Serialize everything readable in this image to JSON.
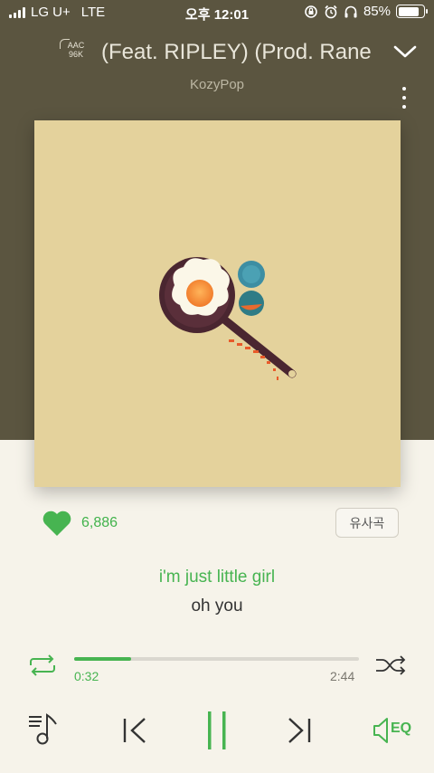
{
  "status_bar": {
    "carrier": "LG U+",
    "network": "LTE",
    "time": "오후 12:01",
    "battery": "85%",
    "battery_level": 0.85
  },
  "header": {
    "codec_line1": "AAC",
    "codec_line2": "96K",
    "title": "(Feat. RIPLEY) (Prod. Rane",
    "artist": "KozyPop"
  },
  "like": {
    "count": "6,886",
    "similar_label": "유사곡"
  },
  "lyrics": {
    "current": "i'm just little girl",
    "next": "oh you"
  },
  "progress": {
    "elapsed": "0:32",
    "total": "2:44",
    "fraction": 0.2
  },
  "controls": {
    "eq_label": "EQ"
  },
  "colors": {
    "accent": "#47b451",
    "header_bg": "#5b5540",
    "body_bg": "#f6f3ea",
    "album_bg": "#e4d29c"
  }
}
